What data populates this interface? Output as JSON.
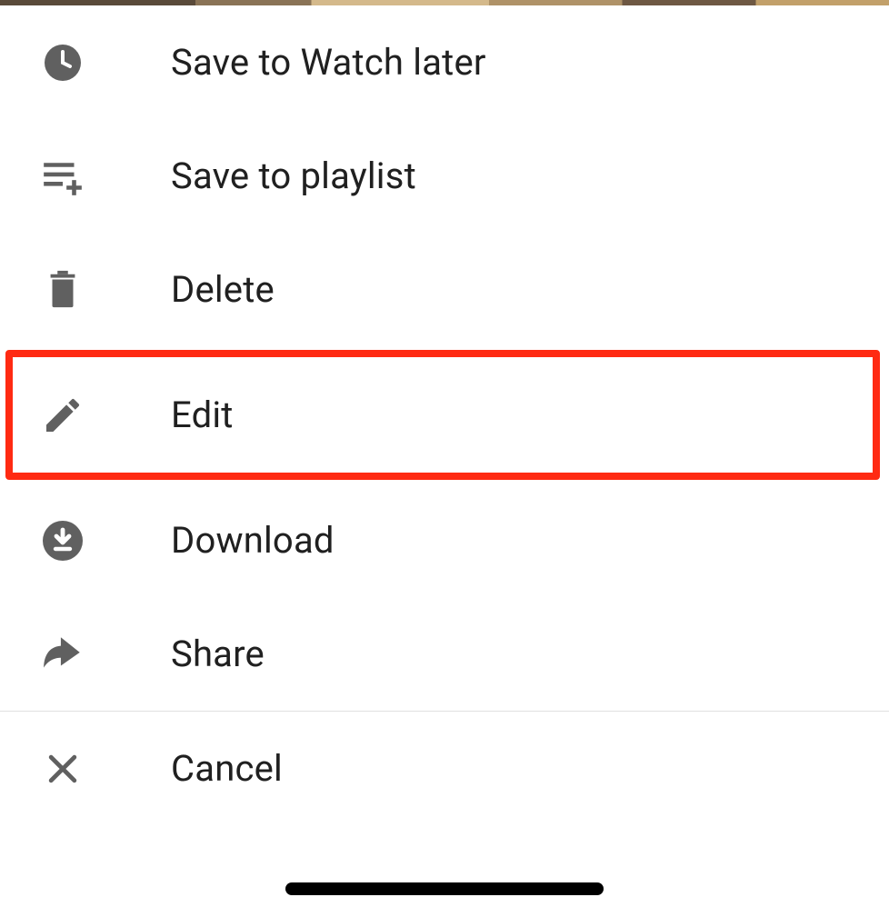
{
  "menu": {
    "items": [
      {
        "label": "Save to Watch later"
      },
      {
        "label": "Save to playlist"
      },
      {
        "label": "Delete"
      },
      {
        "label": "Edit"
      },
      {
        "label": "Download"
      },
      {
        "label": "Share"
      }
    ],
    "cancel_label": "Cancel"
  },
  "colors": {
    "icon": "#606060",
    "highlight": "#ff2a12"
  }
}
